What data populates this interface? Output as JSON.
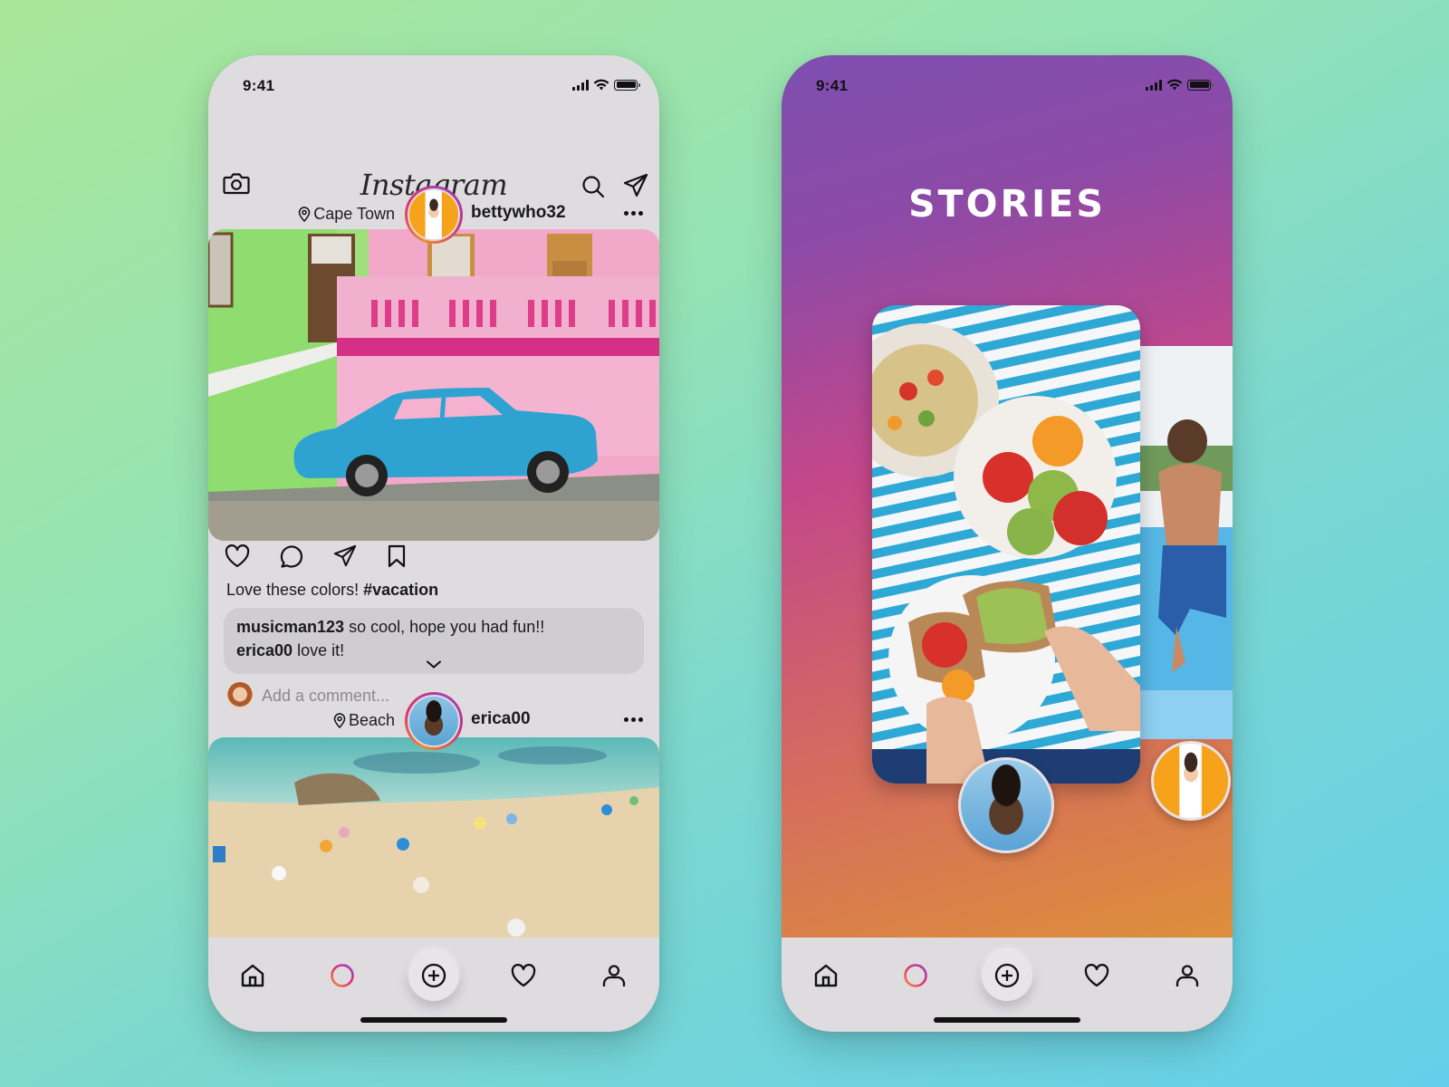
{
  "status": {
    "time": "9:41"
  },
  "feed": {
    "app_title": "Instagram",
    "posts": [
      {
        "location": "Cape Town",
        "username": "bettywho32",
        "caption_text": "Love these colors!",
        "caption_hashtag": "#vacation",
        "comments": [
          {
            "user": "musicman123",
            "text": "so cool, hope you had fun!!"
          },
          {
            "user": "erica00",
            "text": "love it!"
          }
        ],
        "add_comment_placeholder": "Add a comment..."
      },
      {
        "location": "Beach",
        "username": "erica00"
      }
    ]
  },
  "stories": {
    "title": "STORIES"
  },
  "tabbar": {
    "items": [
      {
        "icon": "home-icon"
      },
      {
        "icon": "stories-ring-icon"
      },
      {
        "icon": "add-post-icon"
      },
      {
        "icon": "heart-icon"
      },
      {
        "icon": "profile-icon"
      }
    ]
  },
  "colors": {
    "gradient_orange": "#f18a2b",
    "gradient_pink": "#e2306c",
    "gradient_purple": "#a53fb7",
    "phone_surface": "#dedcdf"
  }
}
